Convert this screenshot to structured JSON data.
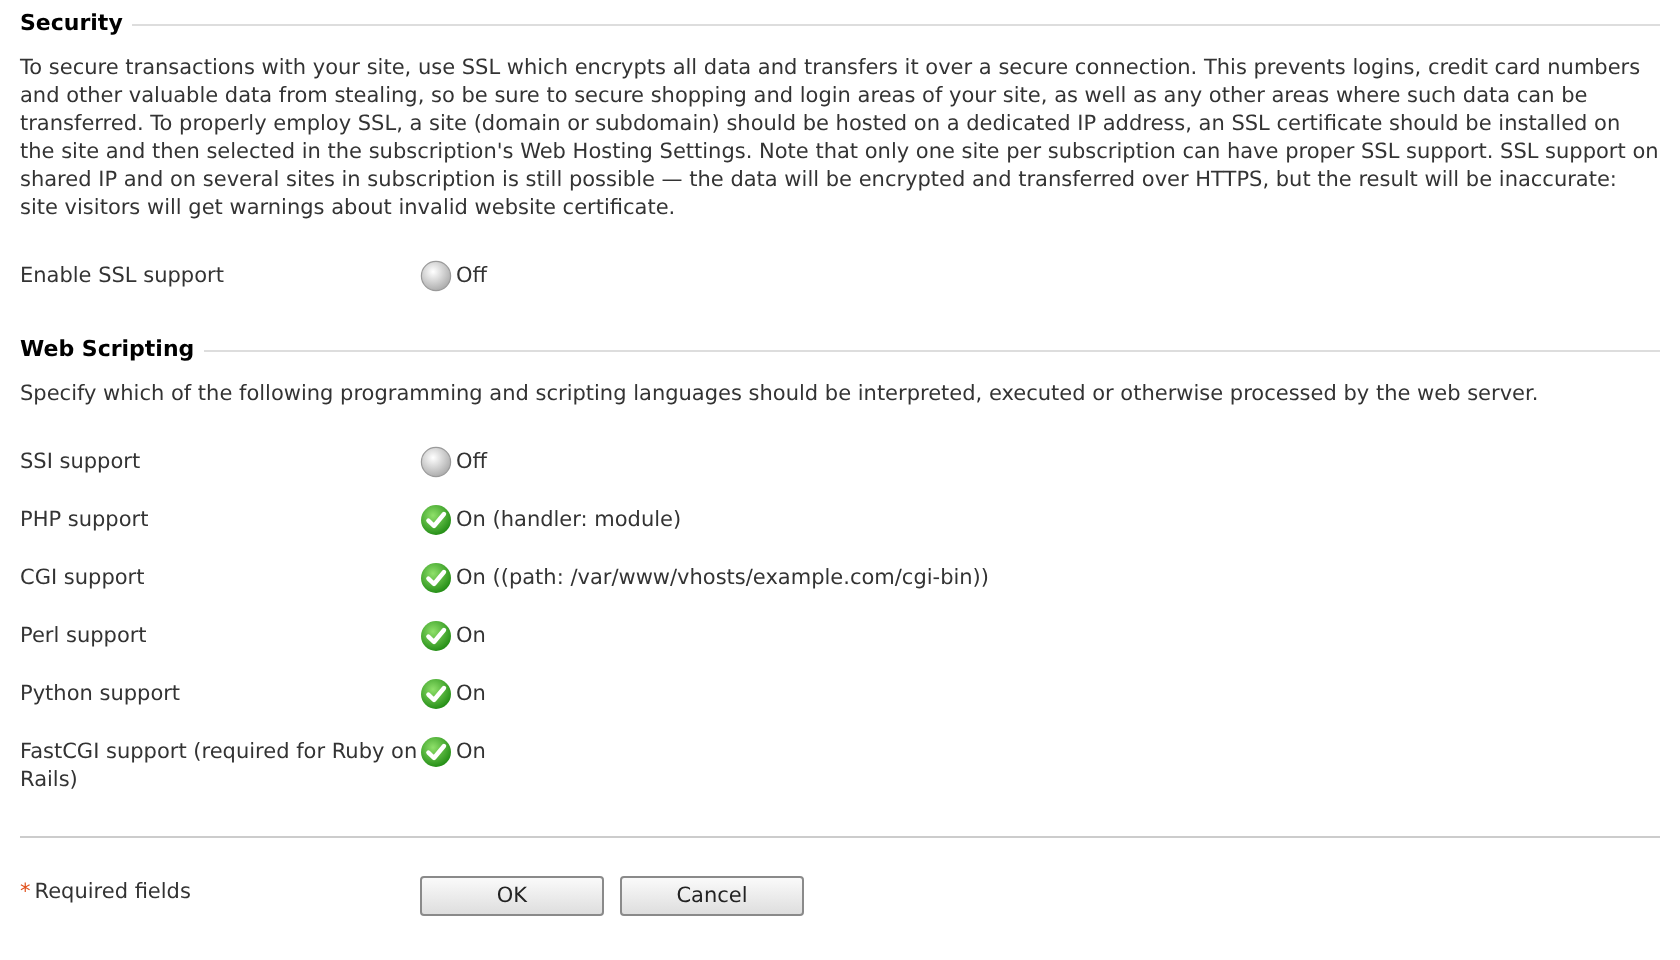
{
  "sections": [
    {
      "title": "Security",
      "description": "To secure transactions with your site, use SSL which encrypts all data and transfers it over a secure connection. This prevents logins, credit card numbers and other valuable data from stealing, so be sure to secure shopping and login areas of your site, as well as any other areas where such data can be transferred. To properly employ SSL, a site (domain or subdomain) should be hosted on a dedicated IP address, an SSL certificate should be installed on the site and then selected in the subscription's Web Hosting Settings. Note that only one site per subscription can have proper SSL support. SSL support on shared IP and on several sites in subscription is still possible — the data will be encrypted and transferred over HTTPS, but the result will be inaccurate: site visitors will get warnings about invalid website certificate.",
      "settings": [
        {
          "label": "Enable SSL support",
          "on": false,
          "value": "Off"
        }
      ]
    },
    {
      "title": "Web Scripting",
      "description": "Specify which of the following programming and scripting languages should be interpreted, executed or otherwise processed by the web server.",
      "settings": [
        {
          "label": "SSI support",
          "on": false,
          "value": "Off"
        },
        {
          "label": "PHP support",
          "on": true,
          "value": "On (handler: module)"
        },
        {
          "label": "CGI support",
          "on": true,
          "value": "On ((path: /var/www/vhosts/example.com/cgi-bin))"
        },
        {
          "label": "Perl support",
          "on": true,
          "value": "On"
        },
        {
          "label": "Python support",
          "on": true,
          "value": "On"
        },
        {
          "label": "FastCGI support (required for Ruby on Rails)",
          "on": true,
          "value": "On"
        }
      ]
    }
  ],
  "required_note": {
    "mark": "*",
    "label": "Required fields"
  },
  "buttons": [
    "OK",
    "Cancel"
  ]
}
